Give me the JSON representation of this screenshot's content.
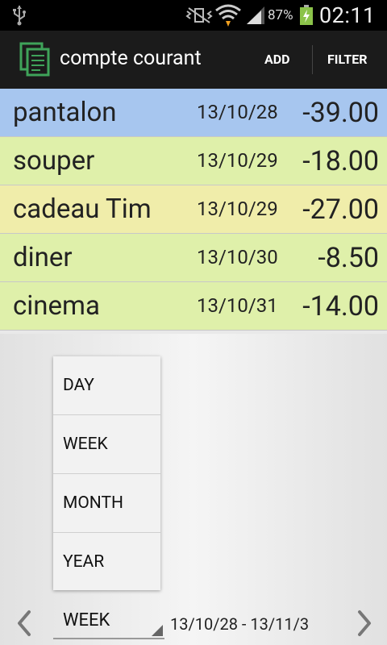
{
  "status_bar": {
    "battery_percent": "87%",
    "time": "02:11"
  },
  "action_bar": {
    "title": "compte courant",
    "add_label": "ADD",
    "filter_label": "FILTER"
  },
  "transactions": [
    {
      "name": "pantalon",
      "date": "13/10/28",
      "amount": "-39.00",
      "color": "#a7c6ef"
    },
    {
      "name": "souper",
      "date": "13/10/29",
      "amount": "-18.00",
      "color": "#dff0aa"
    },
    {
      "name": "cadeau Tim",
      "date": "13/10/29",
      "amount": "-27.00",
      "color": "#f0edaa"
    },
    {
      "name": "diner",
      "date": "13/10/30",
      "amount": "-8.50",
      "color": "#dff0aa"
    },
    {
      "name": "cinema",
      "date": "13/10/31",
      "amount": "-14.00",
      "color": "#dff0aa"
    }
  ],
  "period_dropdown": {
    "options": [
      "DAY",
      "WEEK",
      "MONTH",
      "YEAR"
    ]
  },
  "bottom_bar": {
    "selected_period": "WEEK",
    "date_range": "13/10/28 - 13/11/3"
  }
}
